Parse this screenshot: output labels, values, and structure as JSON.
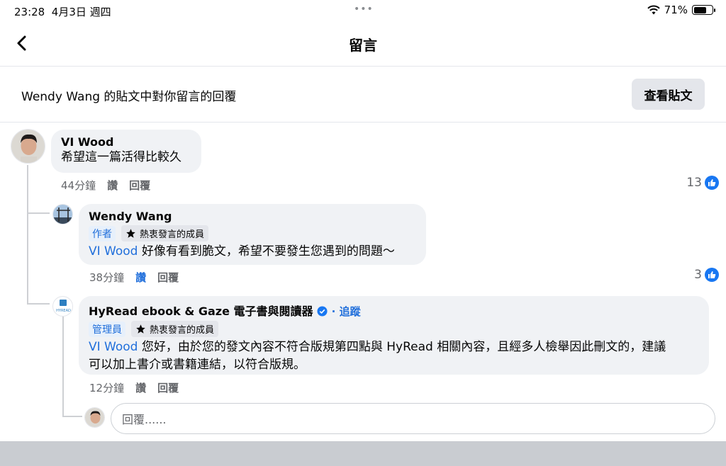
{
  "status": {
    "time": "23:28",
    "date": "4月3日 週四",
    "battery": "71%"
  },
  "nav": {
    "title": "留言"
  },
  "banner": {
    "text": "Wendy Wang 的貼文中對你留言的回覆",
    "button": "查看貼文"
  },
  "comments": [
    {
      "name": "VI Wood",
      "text": "希望這一篇活得比較久",
      "time": "44分鐘",
      "read": "讚",
      "reply": "回覆",
      "likes": "13"
    },
    {
      "name": "Wendy Wang",
      "role": "作者",
      "badge": "熱衷發言的成員",
      "mention": "VI Wood",
      "text": " 好像有看到脆文，希望不要發生您遇到的問題～",
      "time": "38分鐘",
      "read": "讚",
      "reply": "回覆",
      "likes": "3"
    },
    {
      "name": "HyRead ebook & Gaze 電子書與閱讀器",
      "follow": "· 追蹤",
      "role": "管理員",
      "badge": "熱衷發言的成員",
      "mention": "VI Wood",
      "text_line1": " 您好，由於您的發文內容不符合版規第四點與 HyRead 相關內容，且經多人檢舉因此刪文的，建議",
      "text_line2": "可以加上書介或書籍連結，以符合版規。",
      "time": "12分鐘",
      "read": "讚",
      "reply": "回覆",
      "logo_text": "HYREAD"
    }
  ],
  "reply_box": {
    "placeholder": "回覆......"
  }
}
